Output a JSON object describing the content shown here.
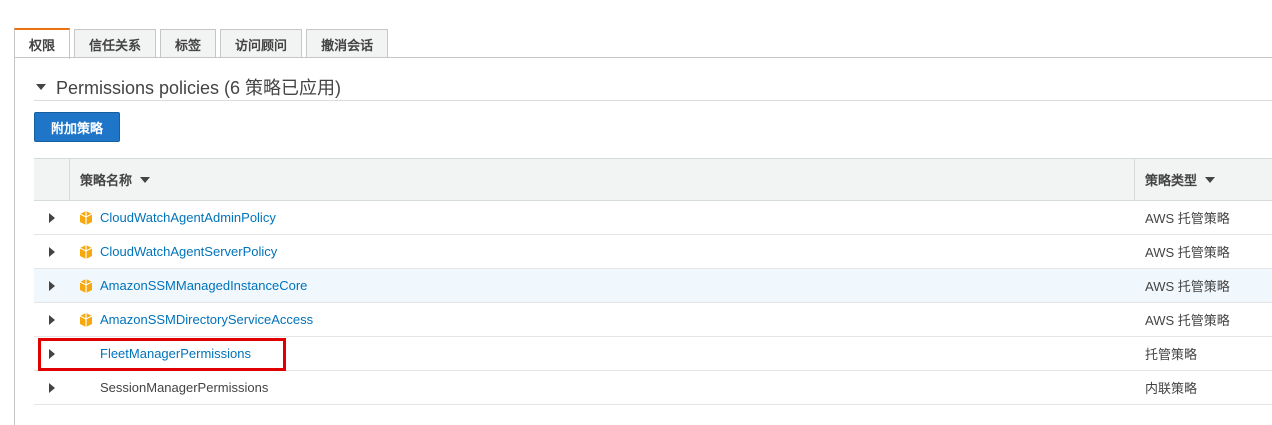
{
  "top_clip": {
    "text": "",
    "link": ""
  },
  "tabs": [
    {
      "label": "权限",
      "active": true
    },
    {
      "label": "信任关系",
      "active": false
    },
    {
      "label": "标签",
      "active": false
    },
    {
      "label": "访问顾问",
      "active": false
    },
    {
      "label": "撤消会话",
      "active": false
    }
  ],
  "section": {
    "title": "Permissions policies (6 策略已应用)"
  },
  "attach_button": {
    "label": "附加策略"
  },
  "table": {
    "columns": {
      "name": "策略名称",
      "type": "策略类型"
    },
    "rows": [
      {
        "name": "CloudWatchAgentAdminPolicy",
        "type": "AWS 托管策略",
        "aws_icon": true,
        "link": true
      },
      {
        "name": "CloudWatchAgentServerPolicy",
        "type": "AWS 托管策略",
        "aws_icon": true,
        "link": true
      },
      {
        "name": "AmazonSSMManagedInstanceCore",
        "type": "AWS 托管策略",
        "aws_icon": true,
        "link": true
      },
      {
        "name": "AmazonSSMDirectoryServiceAccess",
        "type": "AWS 托管策略",
        "aws_icon": true,
        "link": true
      },
      {
        "name": "FleetManagerPermissions",
        "type": "托管策略",
        "aws_icon": false,
        "link": true
      },
      {
        "name": "SessionManagerPermissions",
        "type": "内联策略",
        "aws_icon": false,
        "link": false
      }
    ]
  },
  "colors": {
    "accent": "#ec7211",
    "link": "#0073bb",
    "button": "#1f76c9",
    "highlight_box": "#e00000",
    "aws_icon": "#f7a80d"
  }
}
